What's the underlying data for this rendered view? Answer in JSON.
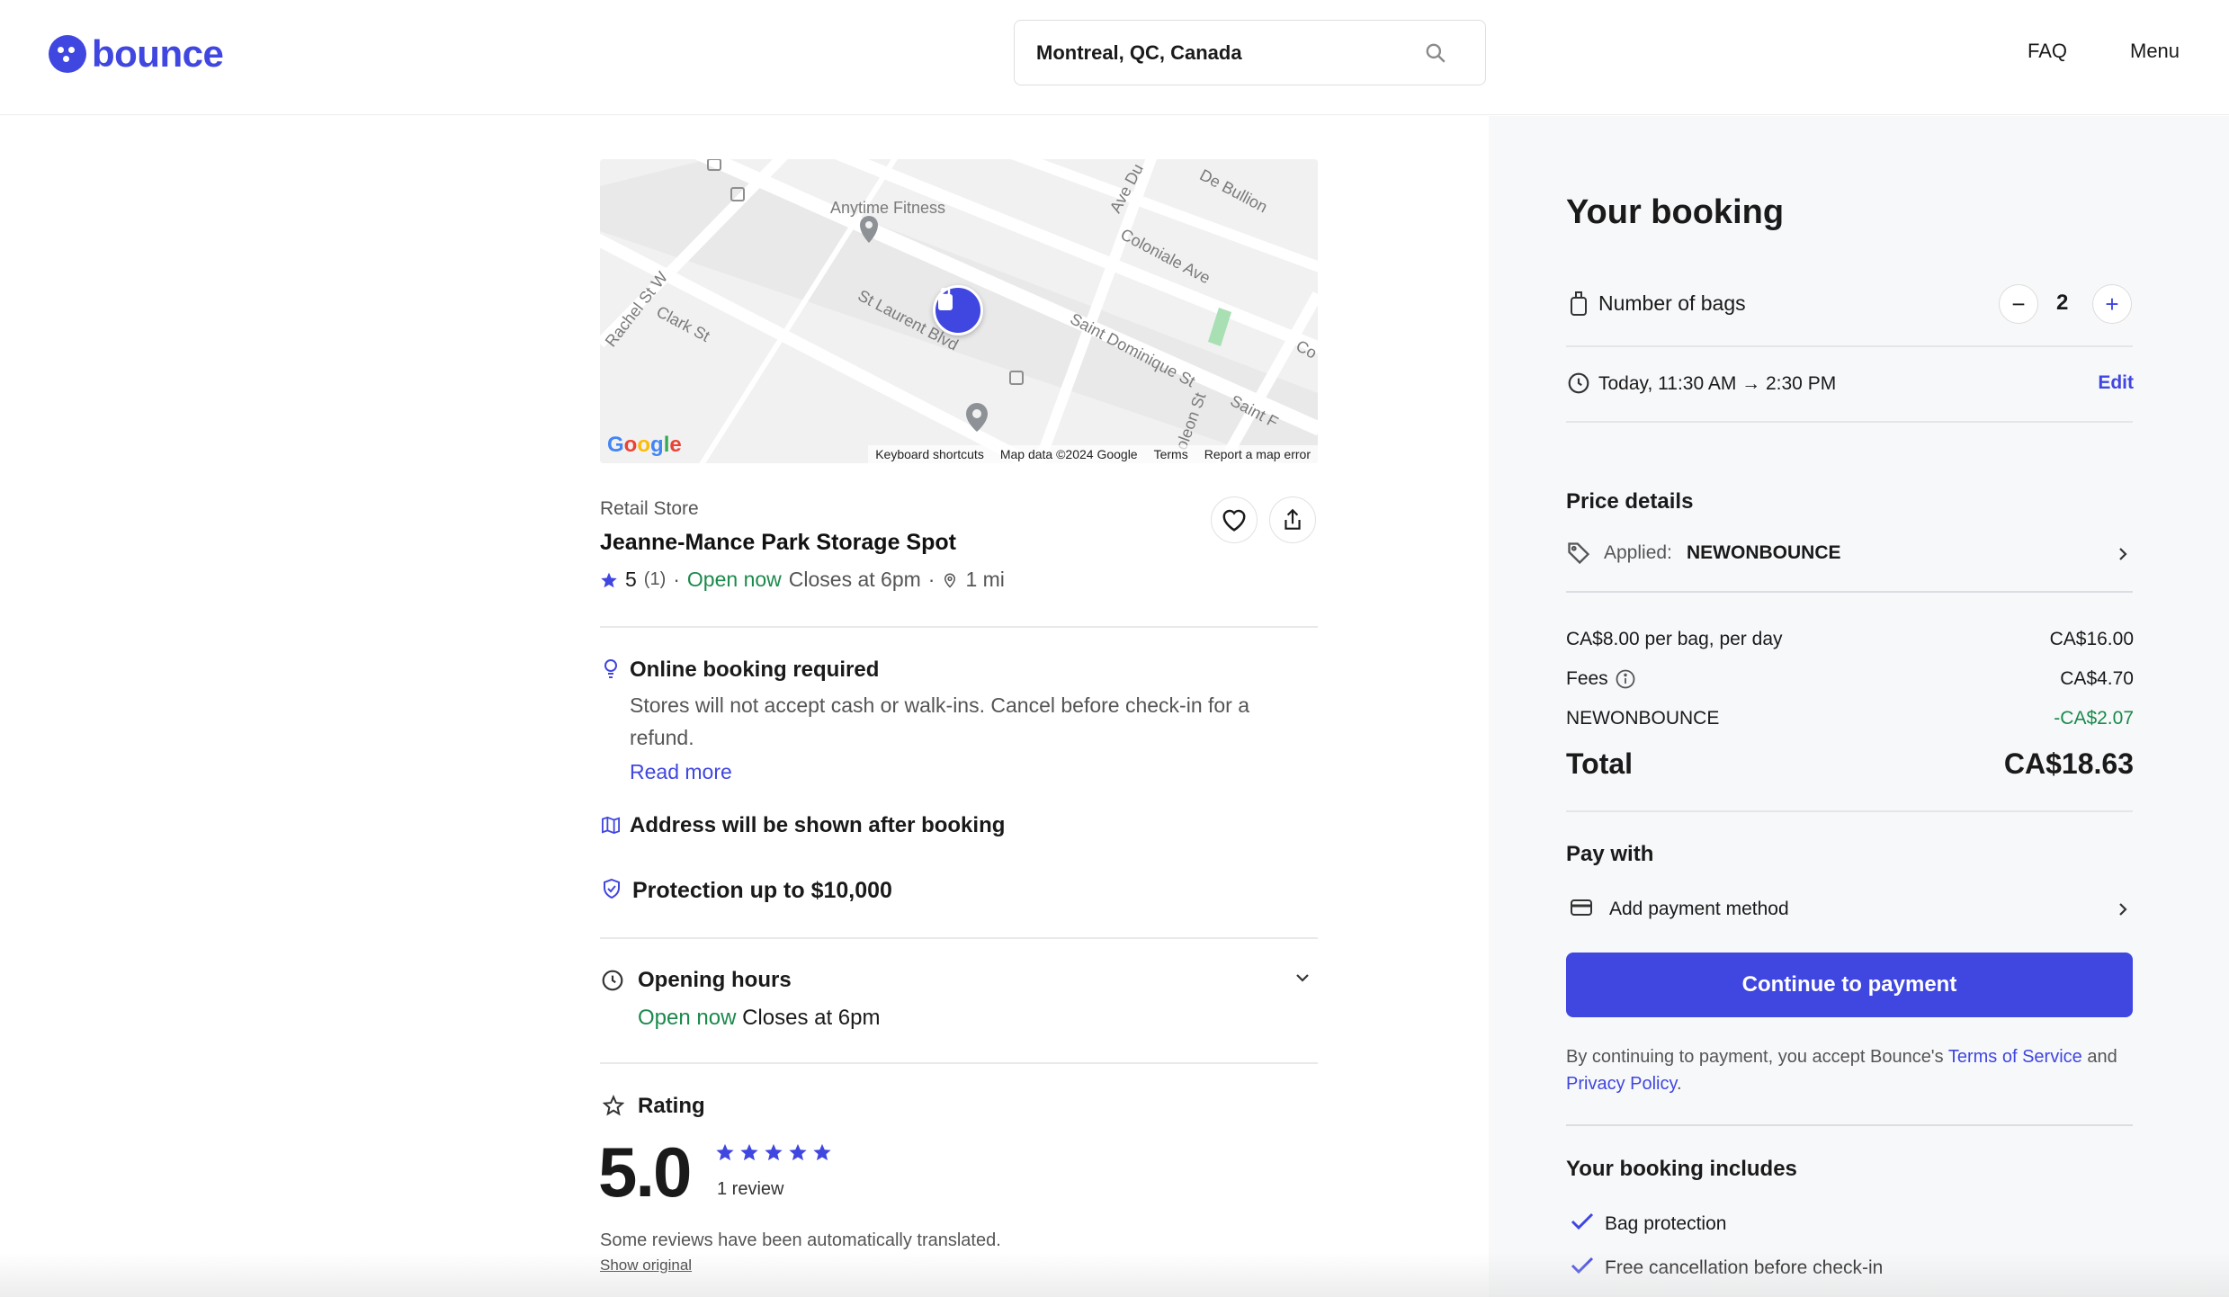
{
  "header": {
    "brand": "bounce",
    "search_value": "Montreal, QC, Canada",
    "nav": {
      "faq": "FAQ",
      "menu": "Menu"
    }
  },
  "map": {
    "labels": {
      "anytime": "Anytime Fitness",
      "rachel": "Rachel St W",
      "clark": "Clark St",
      "stlaurent": "St Laurent Blvd",
      "coloniale": "Coloniale Ave",
      "stdominique": "Saint Dominique St",
      "debullion": "De Bullion",
      "avedu": "Ave Du",
      "st": "St",
      "napoleon": "oleon St",
      "saintf": "Saint F",
      "co": "Co"
    },
    "google": "Google",
    "footer": {
      "shortcuts": "Keyboard shortcuts",
      "data": "Map data ©2024 Google",
      "terms": "Terms",
      "report": "Report a map error"
    }
  },
  "store": {
    "type": "Retail Store",
    "name": "Jeanne-Mance Park Storage Spot",
    "rating": "5",
    "rating_count": "(1)",
    "sep": "·",
    "open_status": "Open now",
    "closes": "Closes at 6pm",
    "distance": "1 mi"
  },
  "info": {
    "booking_title": "Online booking required",
    "booking_text": "Stores will not accept cash or walk-ins. Cancel before check-in for a refund.",
    "read_more": "Read more",
    "address_title": "Address will be shown after booking",
    "protection_title": "Protection up to $10,000"
  },
  "hours": {
    "title": "Opening hours",
    "open_status": "Open now",
    "closes": "Closes at 6pm"
  },
  "rating_section": {
    "title": "Rating",
    "score": "5.0",
    "stars": 5,
    "review_count": "1 review",
    "translated_note": "Some reviews have been automatically translated.",
    "show_original": "Show original"
  },
  "booking": {
    "title": "Your booking",
    "bags_label": "Number of bags",
    "bags_count": "2",
    "minus": "−",
    "plus": "+",
    "time": "Today, 11:30 AM → 2:30 PM",
    "edit": "Edit",
    "price_title": "Price details",
    "applied_label": "Applied:",
    "promo_code": "NEWONBOUNCE",
    "lines": [
      {
        "label": "CA$8.00 per bag, per day",
        "value": "CA$16.00"
      },
      {
        "label": "Fees",
        "value": "CA$4.70"
      },
      {
        "label": "NEWONBOUNCE",
        "value": "-CA$2.07"
      }
    ],
    "total_label": "Total",
    "total_value": "CA$18.63",
    "pay_title": "Pay with",
    "add_payment": "Add payment method",
    "cta": "Continue to payment",
    "terms_pre": "By continuing to payment, you accept Bounce's ",
    "terms_link": "Terms of Service",
    "terms_and": " and ",
    "privacy_link": "Privacy Policy",
    "terms_end": ".",
    "includes_title": "Your booking includes",
    "includes": [
      "Bag protection",
      "Free cancellation before check-in"
    ]
  },
  "colors": {
    "brand": "#4046e0",
    "open_green": "#1b8a4c",
    "discount_green": "#1b8a4c"
  }
}
